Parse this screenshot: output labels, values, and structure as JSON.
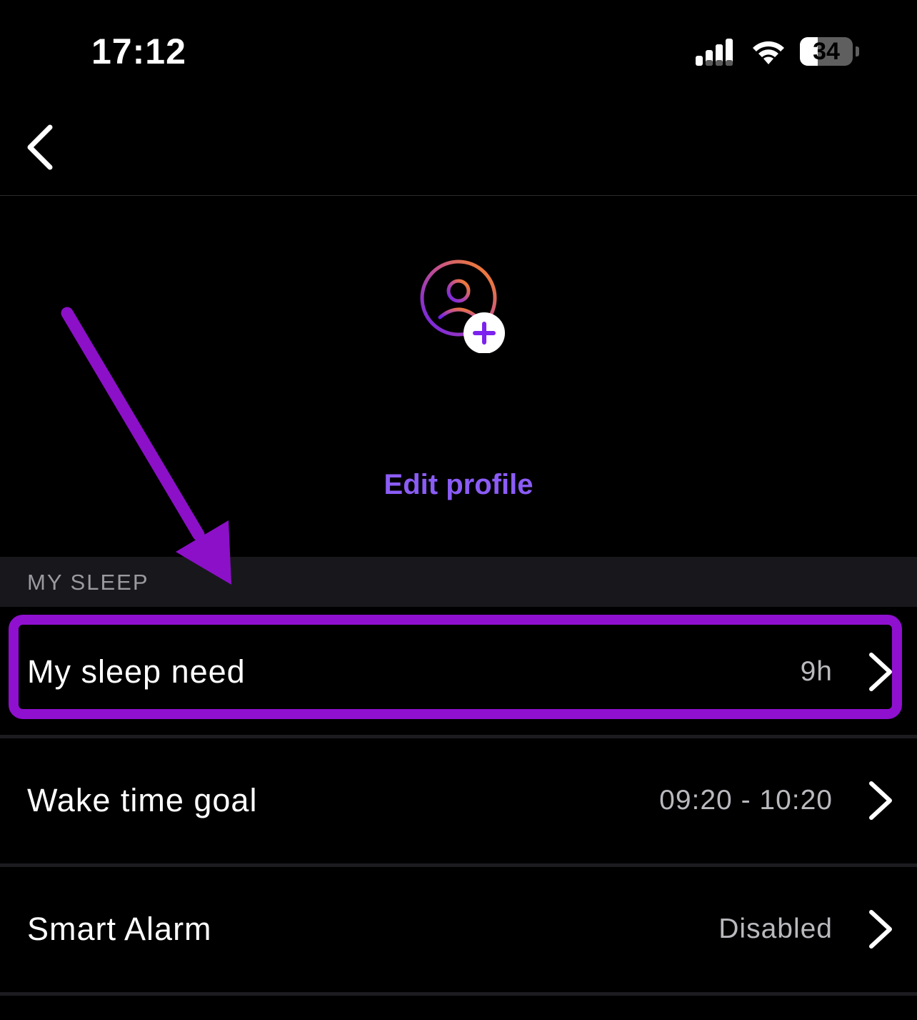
{
  "status_bar": {
    "time": "17:12",
    "battery_level": "34",
    "battery_fraction": 0.34,
    "signal_icon": "cellular-signal-icon",
    "wifi_icon": "wifi-icon"
  },
  "nav": {
    "back_icon": "chevron-left-icon"
  },
  "profile": {
    "avatar_icon": "person-add-icon",
    "edit_label": "Edit profile"
  },
  "sections": {
    "my_sleep": {
      "header": "MY SLEEP",
      "rows": [
        {
          "label": "My sleep need",
          "value": "9h"
        },
        {
          "label": "Wake time goal",
          "value": "09:20 - 10:20"
        },
        {
          "label": "Smart Alarm",
          "value": "Disabled"
        }
      ]
    }
  },
  "annotations": {
    "highlight_color": "#9010d0",
    "arrow_color": "#8c10c8"
  },
  "colors": {
    "accent": "#8b5cf6",
    "background": "#000000",
    "section_header_bg": "#18181c",
    "value_text": "#b9b9be"
  }
}
